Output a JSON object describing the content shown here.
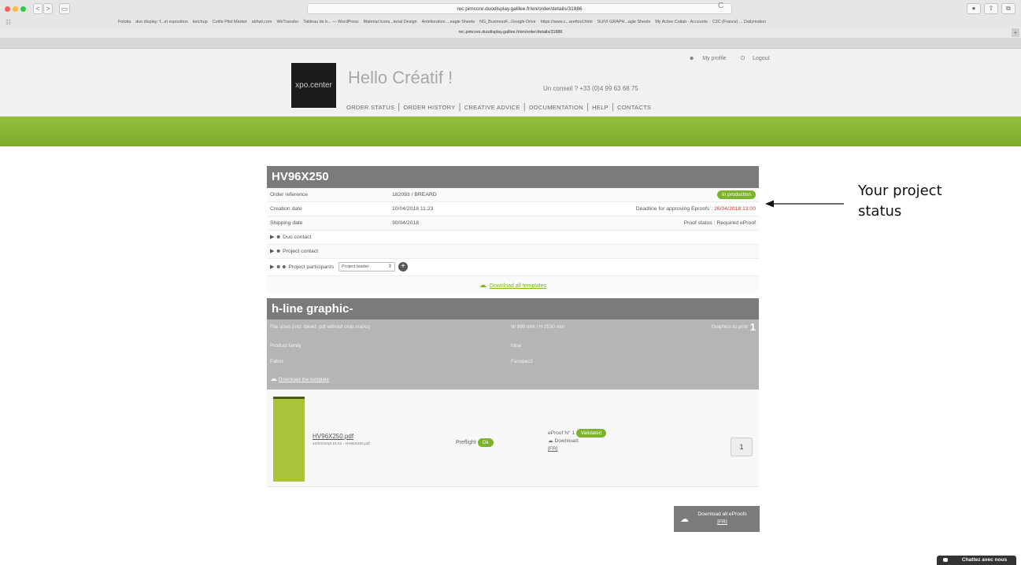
{
  "browser": {
    "nav_back": "<",
    "nav_fwd": ">",
    "sidebar": "▭",
    "url": "rec.pimcore.duodisplay.galilee.fr/en/order/details/31886",
    "reload": "C",
    "bookmarks": [
      "Fotolia",
      "duo display: f...et exposition",
      "ketchup",
      "Cuttle Pilot Market",
      "abhwl.com",
      "WeTransfer",
      "Tableau de b... — WordPress",
      "Material Icons...terial Design",
      "Amélioration ...eagle Sheets",
      "NG_BusinessF...Google Drive",
      "https://www.c...arettool.html",
      "SUIVI GRAPH...agle Sheets",
      "My Active Collab - Accounts",
      "C2C (France) ... Dailymotion"
    ],
    "tab_title": "rec.pimcore.duodisplay.galilee.fr/en/order/details/31886"
  },
  "header": {
    "logo_text": "xpo.center",
    "greeting": "Hello Créatif !",
    "advice_phone": "Un conseil ? +33 (0)4 99 63 68 75",
    "my_profile": "My profile",
    "logout": "Logout",
    "nav": [
      "ORDER STATUS",
      "ORDER HISTORY",
      "CREATIVE ADVICE",
      "DOCUMENTATION",
      "HELP",
      "CONTACTS"
    ]
  },
  "order": {
    "title": "HV96X250",
    "reference_label": "Order reference",
    "reference_value": "182093 / BREARD",
    "status": "In production",
    "creation_label": "Creation date",
    "creation_value": "10/04/2018 11:23",
    "deadline_label": "Deadline for approving Eproofs :",
    "deadline_value": "26/04/2018 13:00",
    "shipping_label": "Shipping date",
    "shipping_value": "30/04/2018",
    "proof_status": "Proof status : Required eProof",
    "duo_contact": "Duo contact",
    "project_contact": "Project contact",
    "project_participants": "Project participants",
    "participant_select": "Project leader",
    "download_templates": "Download all templates"
  },
  "graphic": {
    "title": "h-line graphic-",
    "file_sizes_label": "File sizes (incl. bleed, pdf without crop marks)",
    "file_sizes_value": "W 990 mm / H 2530 mm",
    "graphics_to_print_label": "Graphics to print",
    "graphics_to_print_value": "1",
    "product_family_label": "Product family",
    "product_family_value": "hline",
    "fabric_label": "Fabric",
    "fabric_value": "Fanopec2",
    "download_template": "Download the template",
    "file_name": "HV96X250.pdf",
    "file_meta": "10/04/2018 16:41 - HV96X250.pdf",
    "preflight_label": "Preflight",
    "preflight_value": "Ok",
    "eproof_label": "eProof N° 1",
    "eproof_status": "Validated",
    "download_label": "Download:",
    "lang": "[FR]",
    "quantity": "1",
    "download_all": "Download all eProofs",
    "download_all_lang": "[FR]"
  },
  "annotation": {
    "line1": "Your project",
    "line2": "status"
  },
  "chat": {
    "label": "Chattez avec nous"
  },
  "colors": {
    "accent_green": "#7cb32b",
    "header_grey": "#7b7b7b",
    "deadline_red": "#e03030"
  }
}
